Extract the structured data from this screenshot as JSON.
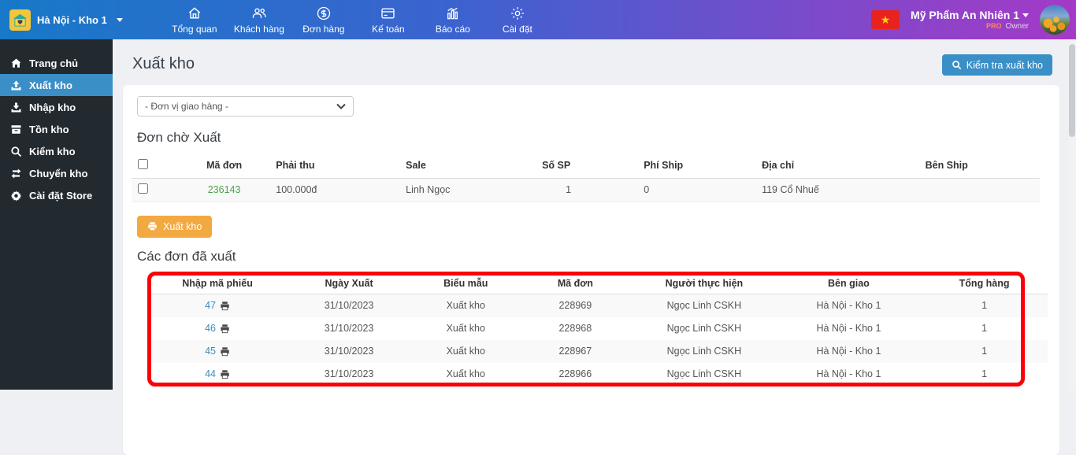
{
  "topbar": {
    "store_label": "Hà Nội - Kho 1",
    "nav": [
      {
        "label": "Tổng quan",
        "icon": "overview-home"
      },
      {
        "label": "Khách hàng",
        "icon": "customers"
      },
      {
        "label": "Đơn hàng",
        "icon": "orders-dollar"
      },
      {
        "label": "Kế toán",
        "icon": "accounting-card"
      },
      {
        "label": "Báo cáo",
        "icon": "reports-chart"
      },
      {
        "label": "Cài đặt",
        "icon": "settings-gear"
      }
    ],
    "flag": "vietnam-flag",
    "flag_star": "★",
    "account": {
      "name": "Mỹ Phẩm An Nhiên 1",
      "plan": "PRO",
      "role": "Owner"
    }
  },
  "sidebar": {
    "items": [
      {
        "label": "Trang chủ",
        "icon": "home",
        "active": false
      },
      {
        "label": "Xuất kho",
        "icon": "export-upload",
        "active": true
      },
      {
        "label": "Nhập kho",
        "icon": "import-download",
        "active": false
      },
      {
        "label": "Tồn kho",
        "icon": "stock-box",
        "active": false
      },
      {
        "label": "Kiểm kho",
        "icon": "audit-search",
        "active": false
      },
      {
        "label": "Chuyển kho",
        "icon": "transfer-arrows",
        "active": false
      },
      {
        "label": "Cài đặt Store",
        "icon": "store-settings-gear",
        "active": false
      }
    ]
  },
  "page": {
    "title": "Xuất kho",
    "check_button_label": "Kiểm tra xuất kho"
  },
  "filters": {
    "delivery_unit_selected": "- Đơn vị giao hàng -"
  },
  "pending_section": {
    "title": "Đơn chờ Xuất",
    "columns": [
      "Mã đơn",
      "Phải thu",
      "Sale",
      "Số SP",
      "Phí Ship",
      "Địa chỉ",
      "Bên Ship"
    ],
    "rows": [
      {
        "ma_don": "236143",
        "phai_thu": "100.000đ",
        "sale": "Linh Ngọc",
        "so_sp": "1",
        "phi_ship": "0",
        "dia_chi": "119 Cổ Nhuế",
        "ben_ship": ""
      }
    ],
    "export_button_label": "Xuất kho"
  },
  "exported_section": {
    "title": "Các đơn đã xuất",
    "columns": [
      "Nhập mã phiếu",
      "Ngày Xuất",
      "Biểu mẫu",
      "Mã đơn",
      "Người thực hiện",
      "Bên giao",
      "Tổng hàng"
    ],
    "rows": [
      {
        "phieu": "47",
        "ngay_xuat": "31/10/2023",
        "bieu_mau": "Xuất kho",
        "ma_don": "228969",
        "nguoi_thuc_hien": "Ngọc Linh CSKH",
        "ben_giao": "Hà Nội - Kho 1",
        "tong_hang": "1"
      },
      {
        "phieu": "46",
        "ngay_xuat": "31/10/2023",
        "bieu_mau": "Xuất kho",
        "ma_don": "228968",
        "nguoi_thuc_hien": "Ngọc Linh CSKH",
        "ben_giao": "Hà Nội - Kho 1",
        "tong_hang": "1"
      },
      {
        "phieu": "45",
        "ngay_xuat": "31/10/2023",
        "bieu_mau": "Xuất kho",
        "ma_don": "228967",
        "nguoi_thuc_hien": "Ngọc Linh CSKH",
        "ben_giao": "Hà Nội - Kho 1",
        "tong_hang": "1"
      },
      {
        "phieu": "44",
        "ngay_xuat": "31/10/2023",
        "bieu_mau": "Xuất kho",
        "ma_don": "228966",
        "nguoi_thuc_hien": "Ngọc Linh CSKH",
        "ben_giao": "Hà Nội - Kho 1",
        "tong_hang": "1"
      }
    ]
  },
  "colors": {
    "topbar_gradient_start": "#1779c8",
    "topbar_gradient_end": "#a43ac6",
    "sidebar_bg": "#222a30",
    "sidebar_active": "#3a8fc7",
    "accent_blue": "#3a8fc7",
    "button_orange": "#f3a942",
    "link_green": "#4ea14e",
    "link_blue": "#3c8dbc",
    "annotation_red": "#fb0007",
    "main_bg": "#eef0f4",
    "logo_yellow": "#f2c53d"
  }
}
